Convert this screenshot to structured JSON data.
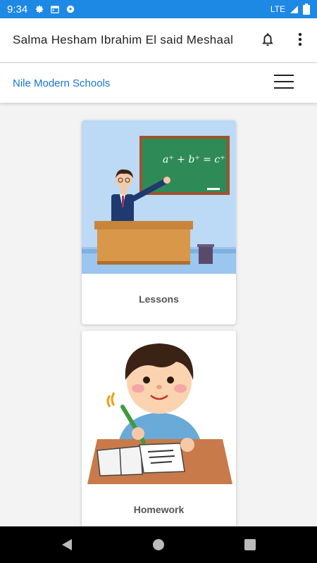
{
  "status_bar": {
    "time": "9:34",
    "icons": [
      "gear-icon",
      "calendar-icon",
      "soccer-ball-icon"
    ],
    "network": "LTE",
    "signal_icon": "signal-icon",
    "battery_icon": "battery-icon"
  },
  "app_bar": {
    "title": "Salma Hesham Ibrahim El said Meshaal",
    "notification_icon": "bell-icon",
    "menu_icon": "more-vert-icon"
  },
  "school_bar": {
    "name": "Nile Modern Schools",
    "menu_icon": "hamburger-icon"
  },
  "cards": [
    {
      "label": "Lessons",
      "illustration": "teacher-at-blackboard",
      "board_text": "a⁺ + b⁺ = c⁺"
    },
    {
      "label": "Homework",
      "illustration": "boy-writing-homework"
    }
  ],
  "colors": {
    "status_bar": "#1e88e5",
    "accent_link": "#1976d2",
    "background": "#f3f3f3",
    "nav_bar": "#000000"
  },
  "nav_bar": {
    "buttons": [
      "back-icon",
      "home-icon",
      "recents-icon"
    ]
  }
}
